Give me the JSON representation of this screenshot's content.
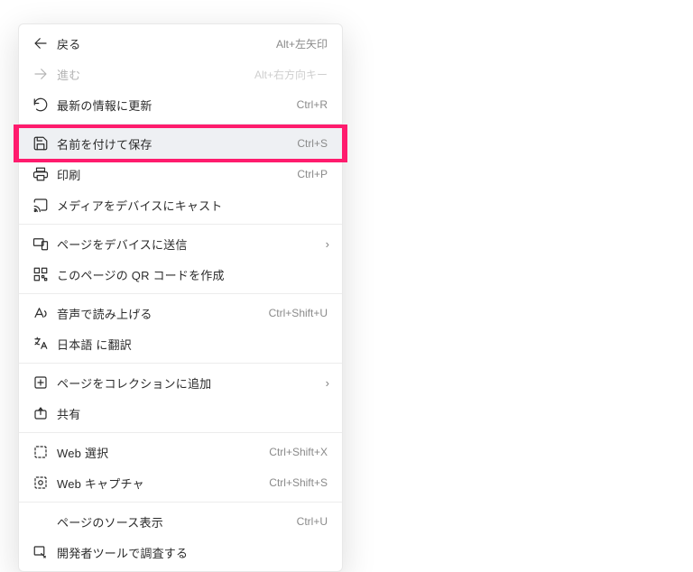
{
  "menu": {
    "back": {
      "label": "戻る",
      "hotkey": "Alt+左矢印"
    },
    "forward": {
      "label": "進む",
      "hotkey": "Alt+右方向キー"
    },
    "reload": {
      "label": "最新の情報に更新",
      "hotkey": "Ctrl+R"
    },
    "saveAs": {
      "label": "名前を付けて保存",
      "hotkey": "Ctrl+S"
    },
    "print": {
      "label": "印刷",
      "hotkey": "Ctrl+P"
    },
    "cast": {
      "label": "メディアをデバイスにキャスト"
    },
    "send": {
      "label": "ページをデバイスに送信"
    },
    "qr": {
      "label": "このページの QR コードを作成"
    },
    "readAloud": {
      "label": "音声で読み上げる",
      "hotkey": "Ctrl+Shift+U"
    },
    "translate": {
      "label": "日本語 に翻訳"
    },
    "collections": {
      "label": "ページをコレクションに追加"
    },
    "share": {
      "label": "共有"
    },
    "webSelect": {
      "label": "Web 選択",
      "hotkey": "Ctrl+Shift+X"
    },
    "webCapture": {
      "label": "Web キャプチャ",
      "hotkey": "Ctrl+Shift+S"
    },
    "viewSource": {
      "label": "ページのソース表示",
      "hotkey": "Ctrl+U"
    },
    "devTools": {
      "label": "開発者ツールで調査する"
    }
  },
  "chevron": "›"
}
